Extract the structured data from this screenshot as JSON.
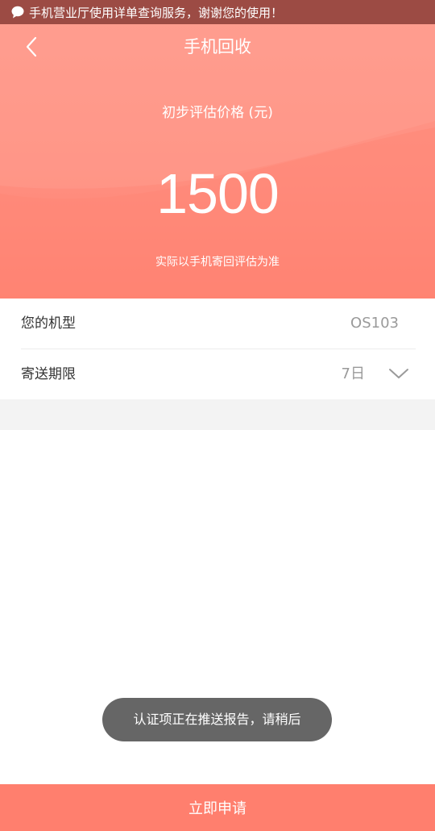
{
  "notification": {
    "icon": "chat-bubble-icon",
    "text": "手机营业厅使用详单查询服务，谢谢您的使用！"
  },
  "header": {
    "back_icon": "chevron-left-icon",
    "title": "手机回收",
    "price_label": "初步评估价格 (元)",
    "price": "1500",
    "note": "实际以手机寄回评估为准"
  },
  "details": {
    "model": {
      "label": "您的机型",
      "value": "OS103"
    },
    "shipping": {
      "label": "寄送期限",
      "value": "7日",
      "icon": "chevron-down-icon"
    }
  },
  "toast": "认证项正在推送报告，请稍后",
  "actions": {
    "apply_label": "立即申请"
  },
  "colors": {
    "accent": "#ff7f6e",
    "notification_bg": "#9c4b44",
    "toast_bg": "#666666"
  }
}
